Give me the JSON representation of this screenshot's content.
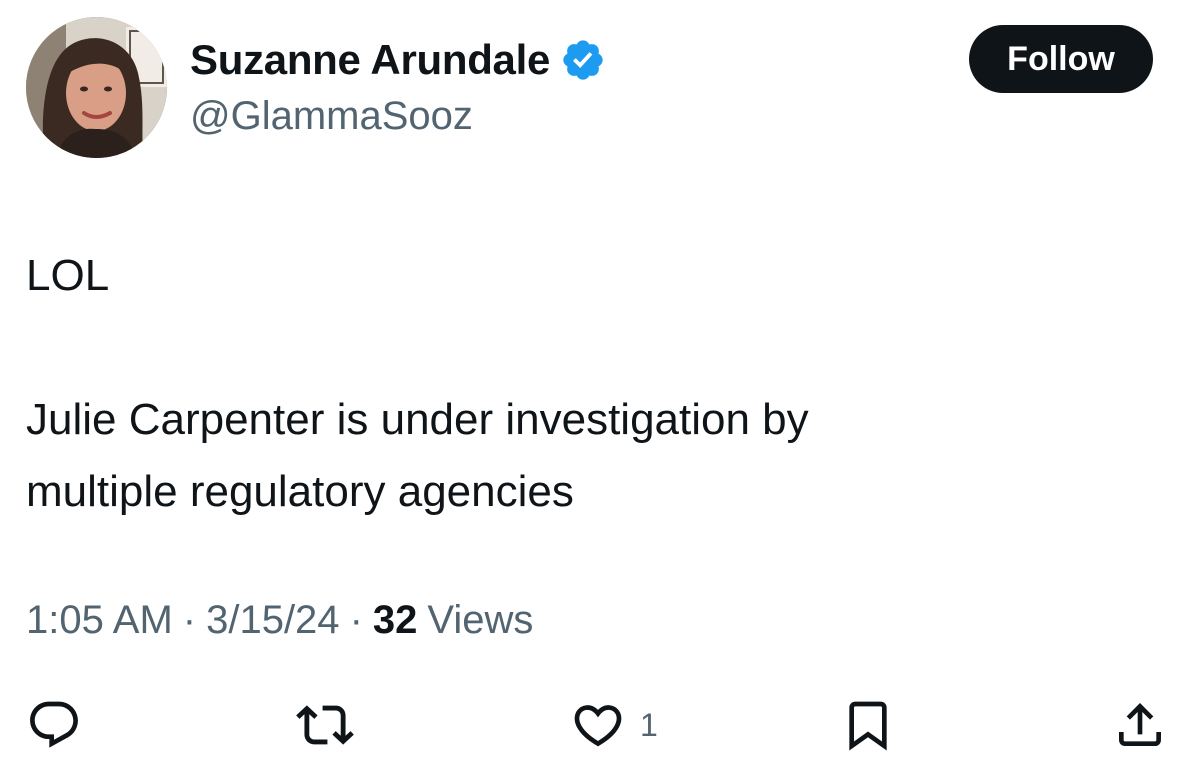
{
  "author": {
    "display_name": "Suzanne Arundale",
    "handle": "@GlammaSooz",
    "verified": true
  },
  "follow_button": {
    "label": "Follow"
  },
  "tweet": {
    "lines": [
      "LOL",
      "Julie Carpenter is under investigation by",
      "multiple regulatory agencies"
    ]
  },
  "meta": {
    "time": "1:05 AM",
    "separator": "·",
    "date": "3/15/24",
    "views_count": "32",
    "views_label": "Views"
  },
  "actions": {
    "like_count": "1"
  },
  "icons": {
    "reply": "reply-icon",
    "retweet": "retweet-icon",
    "like": "heart-icon",
    "bookmark": "bookmark-icon",
    "share": "share-icon",
    "verified": "verified-badge-icon"
  },
  "colors": {
    "text_primary": "#0f1419",
    "text_secondary": "#536471",
    "verified_blue": "#1d9bf0",
    "follow_bg": "#0f1419"
  }
}
